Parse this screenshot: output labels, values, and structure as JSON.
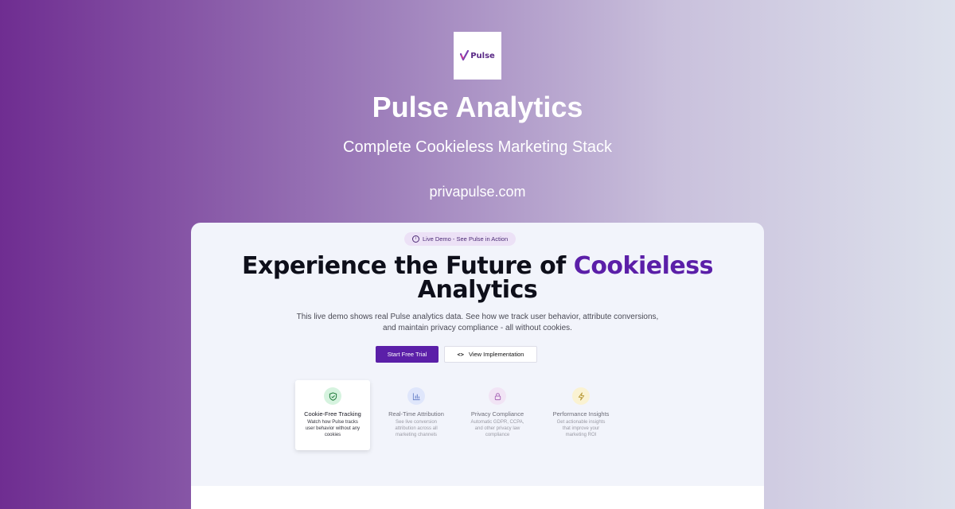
{
  "brand": {
    "logo_text": "Pulse",
    "title": "Pulse Analytics",
    "subtitle": "Complete Cookieless Marketing Stack",
    "domain": "privapulse.com"
  },
  "demo": {
    "badge": "Live Demo - See Pulse in Action",
    "headline_part1": "Experience the Future of",
    "headline_accent": "Cookieless",
    "headline_part2": "Analytics",
    "description": "This live demo shows real Pulse analytics data. See how we track user behavior, attribute conversions, and maintain privacy compliance - all without cookies.",
    "primary_button": "Start Free Trial",
    "secondary_button": "View Implementation"
  },
  "features": [
    {
      "title": "Cookie-Free Tracking",
      "desc": "Watch how Pulse tracks user behavior without any cookies",
      "icon": "shield-check-icon",
      "active": true
    },
    {
      "title": "Real-Time Attribution",
      "desc": "See live conversion attribution across all marketing channels",
      "icon": "bar-chart-icon",
      "active": false
    },
    {
      "title": "Privacy Compliance",
      "desc": "Automatic GDPR, CCPA, and other privacy law compliance",
      "icon": "lock-icon",
      "active": false
    },
    {
      "title": "Performance Insights",
      "desc": "Get actionable insights that improve your marketing ROI",
      "icon": "lightning-icon",
      "active": false
    }
  ],
  "colors": {
    "accent": "#5b1fa8",
    "badge_bg": "#ece1f6",
    "card_bg": "#f2f4fb"
  }
}
